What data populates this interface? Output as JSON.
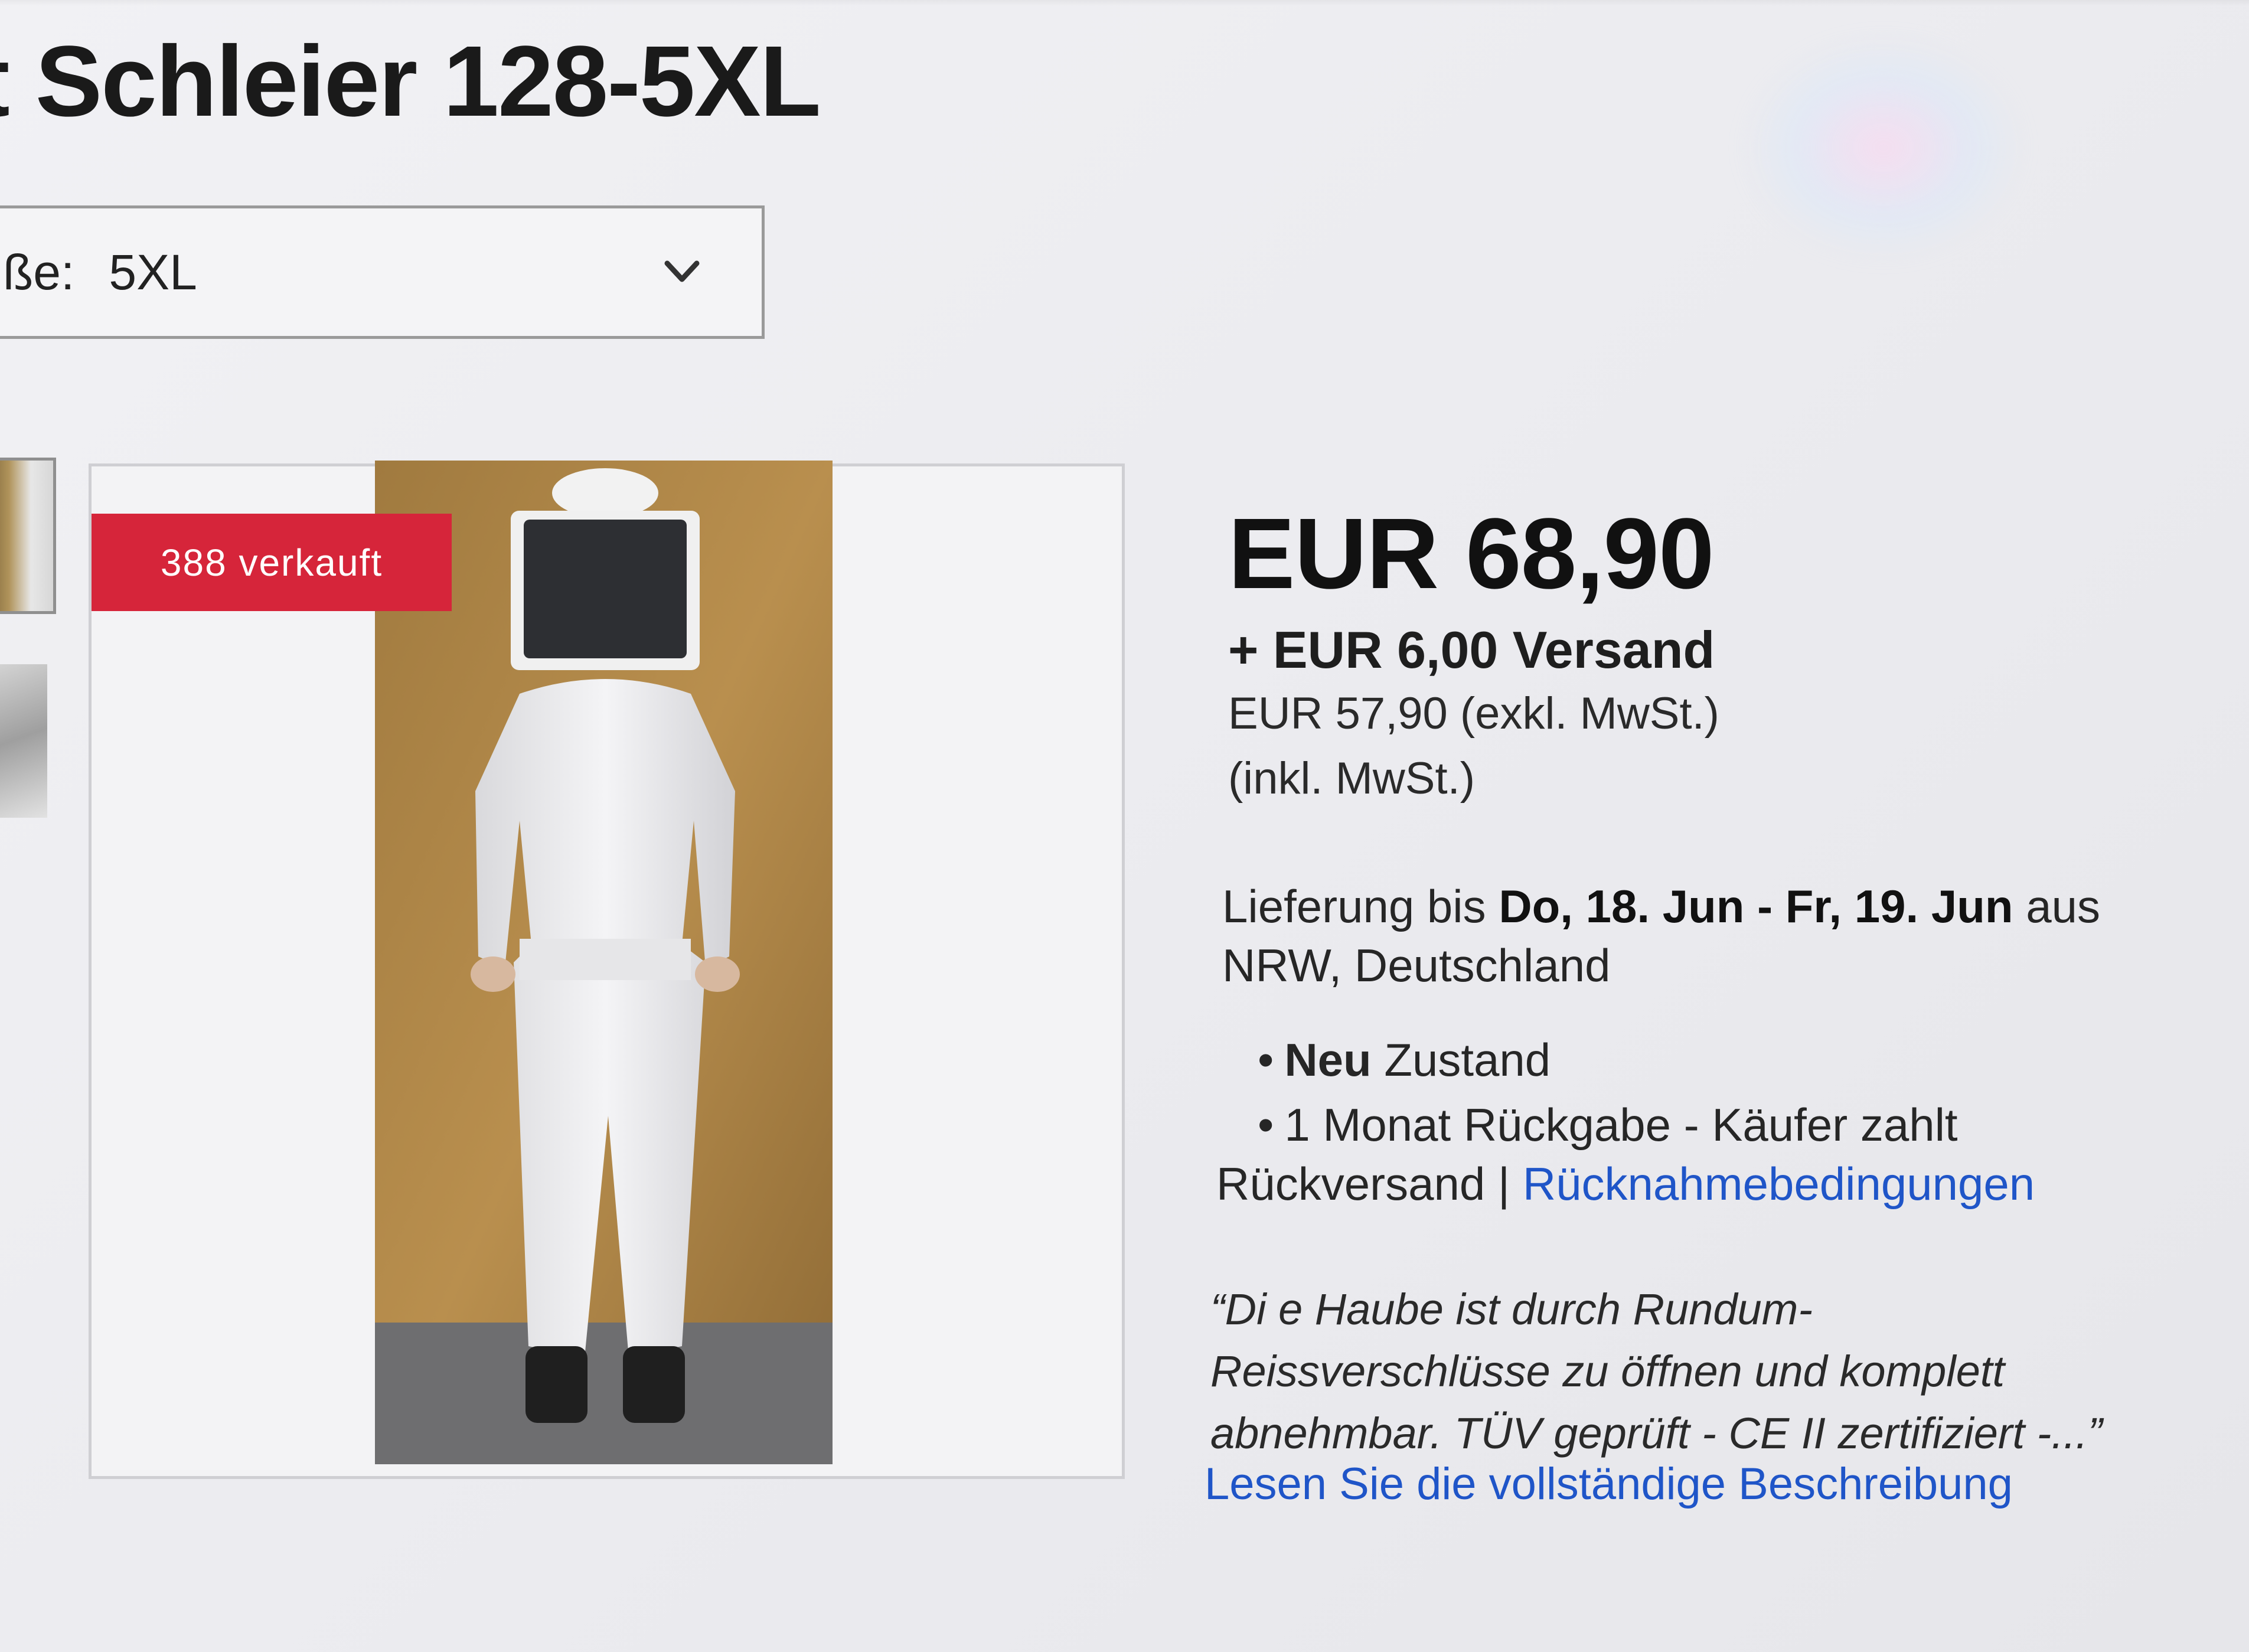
{
  "listing": {
    "title": "t Schleier 128-5XL",
    "size_selector": {
      "label": "ße:",
      "value": "5XL"
    },
    "sold_badge": "388 verkauft",
    "price": "EUR 68,90",
    "shipping": "+ EUR 6,00 Versand",
    "price_ex_vat": "EUR 57,90 (exkl. MwSt.)",
    "vat_note": "(inkl. MwSt.)",
    "delivery": {
      "prefix": "Lieferung bis",
      "dates": "Do, 18. Jun - Fr, 19. Jun",
      "suffix": "aus",
      "origin": "NRW, Deutschland"
    },
    "condition": {
      "value": "Neu",
      "label": "Zustand"
    },
    "returns": {
      "text": "1 Monat Rückgabe - Käufer zahlt",
      "text2": "Rückversand |",
      "link": "Rücknahmebedingungen"
    },
    "description_excerpt": [
      "“Di e Haube ist durch Rundum-",
      "Reissverschlüsse zu öffnen und komplett",
      "abnehmbar. TÜV geprüft - CE II zertifiziert -...”"
    ],
    "read_more": "Lesen Sie die vollständige Beschreibung",
    "icons": {
      "select": "chevron-down-icon"
    },
    "colors": {
      "badge": "#d6253a",
      "link": "#1f55c8"
    }
  }
}
